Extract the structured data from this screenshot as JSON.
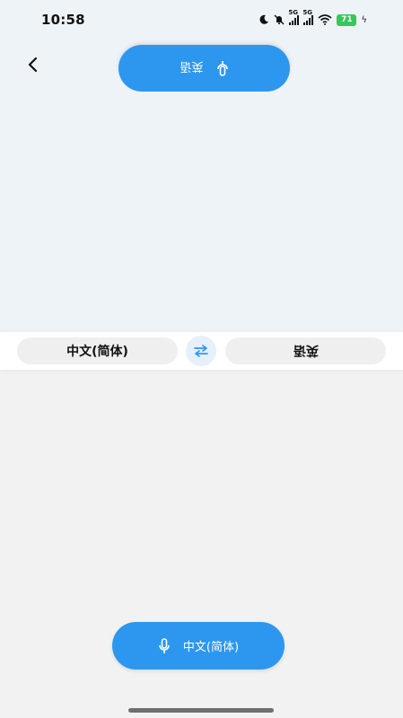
{
  "status_bar": {
    "time": "10:58",
    "network_1": "5G",
    "network_2": "5G",
    "battery": "71"
  },
  "top_panel": {
    "mic_label": "英语"
  },
  "language_bar": {
    "source_language": "中文(简体)",
    "target_language": "英语"
  },
  "bottom_panel": {
    "mic_label": "中文(简体)"
  },
  "colors": {
    "accent": "#2d97ef",
    "top_bg": "#eef3f8",
    "bottom_bg": "#f1f2f1",
    "battery": "#35c759"
  },
  "icons": [
    "back-arrow-icon",
    "microphone-icon",
    "swap-icon",
    "moon-icon",
    "bell-muted-icon",
    "wifi-icon",
    "charging-icon"
  ]
}
